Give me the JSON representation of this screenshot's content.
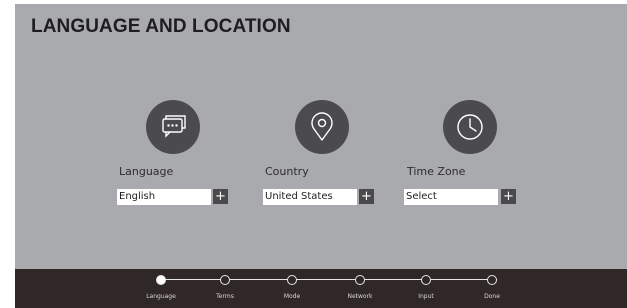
{
  "header": {
    "title": "LANGUAGE AND LOCATION"
  },
  "settings": [
    {
      "label": "Language",
      "value": "English",
      "icon": "chat-bubbles-icon",
      "add": "+"
    },
    {
      "label": "Country",
      "value": "United States",
      "icon": "location-pin-icon",
      "add": "+"
    },
    {
      "label": "Time Zone",
      "value": "Select",
      "icon": "clock-icon",
      "add": "+"
    }
  ],
  "steps": [
    {
      "label": "Language",
      "active": true
    },
    {
      "label": "Terms",
      "active": false
    },
    {
      "label": "Mode",
      "active": false
    },
    {
      "label": "Network",
      "active": false
    },
    {
      "label": "Input",
      "active": false
    },
    {
      "label": "Done",
      "active": false
    }
  ],
  "colors": {
    "panel": "#a9aaae",
    "icon_circle": "#4b4b4f",
    "footer": "#2f2827"
  }
}
